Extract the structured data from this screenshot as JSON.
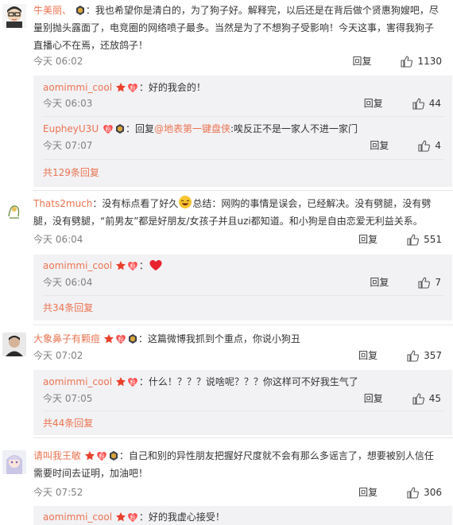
{
  "reply_label": "回复",
  "c1": {
    "user": "牛美丽、",
    "text": "：我也希望你是清白的，为了狗子好。解释完，以后还是在背后做个贤惠狗嫂吧，尽量别抛头露面了，电竞圈的网络喷子最多。当然是为了不想狗子受影响！今天这事，害得我狗子直播心不在焉，还放鸽子！",
    "time": "今天 06:02",
    "likes": "1130",
    "sub1": {
      "user": "aomimmi_cool",
      "text": "：好的我会的！",
      "time": "今天 06:03",
      "likes": "44"
    },
    "sub2": {
      "user": "EupheyU3U",
      "prefix": "：回复",
      "mention": "@地表第一键盘侠",
      "text": ":唉反正不是一家人不进一家门",
      "time": "今天 07:07",
      "likes": "4"
    },
    "more": "共129条回复"
  },
  "c2": {
    "user": "Thats2much",
    "text_a": "：没有标点看了好久",
    "text_b": "总结：网购的事情是误会，已经解决。没有劈腿，没有劈腿，没有劈腿，“前男友”都是好朋友/女孩子并且uzi都知道。和小狗是自由恋爱无利益关系。",
    "time": "今天 06:04",
    "likes": "551",
    "sub1": {
      "user": "aomimmi_cool",
      "text": "：",
      "time": "今天 06:04",
      "likes": "7"
    },
    "more": "共34条回复"
  },
  "c3": {
    "user": "大象鼻子有颗痘",
    "text": "：这篇微博我抓到个重点，你说小狗丑",
    "time": "今天 07:02",
    "likes": "357",
    "sub1": {
      "user": "aomimmi_cool",
      "text": "：什么！？？？说啥呢？？？你这样可不好我生气了",
      "time": "今天 07:05",
      "likes": "45"
    },
    "more": "共44条回复"
  },
  "c4": {
    "user": "请叫我王敏",
    "text": "：自己和别的异性朋友把握好尺度就不会有那么多谣言了，想要被别人信任需要时间去证明，加油吧！",
    "time": "今天 07:52",
    "likes": "306",
    "sub1": {
      "user": "aomimmi_cool",
      "text": "：好的我虚心接受！"
    }
  }
}
